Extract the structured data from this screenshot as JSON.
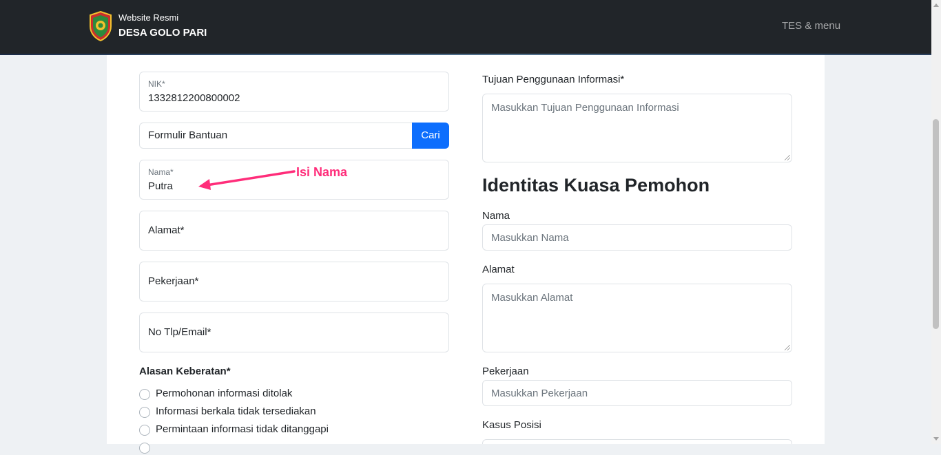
{
  "navbar": {
    "brand_top": "Website Resmi",
    "brand_main": "DESA GOLO PARI",
    "menu": "TES & menu",
    "logo_icon": "village-emblem-icon",
    "background": "#212529"
  },
  "form": {
    "nik": {
      "label": "NIK*",
      "value": "1332812200800002"
    },
    "formulir": {
      "value": "Formulir Bantuan",
      "button": "Cari"
    },
    "nama": {
      "label": "Nama*",
      "value": "Putra"
    },
    "alamat": {
      "label": "Alamat*"
    },
    "pekerjaan": {
      "label": "Pekerjaan*"
    },
    "kontak": {
      "label": "No Tlp/Email*"
    },
    "alasan": {
      "label": "Alasan Keberatan*",
      "options": [
        "Permohonan informasi ditolak",
        "Informasi berkala tidak tersediakan",
        "Permintaan informasi tidak ditanggapi"
      ]
    },
    "tujuan": {
      "label": "Tujuan Penggunaan Informasi*",
      "placeholder": "Masukkan Tujuan Penggunaan Informasi"
    }
  },
  "kuasa": {
    "heading": "Identitas Kuasa Pemohon",
    "nama": {
      "label": "Nama",
      "placeholder": "Masukkan Nama"
    },
    "alamat": {
      "label": "Alamat",
      "placeholder": "Masukkan Alamat"
    },
    "pekerjaan": {
      "label": "Pekerjaan",
      "placeholder": "Masukkan Pekerjaan"
    },
    "kasus": {
      "label": "Kasus Posisi"
    }
  },
  "annotation": {
    "text": "Isi Nama",
    "color": "#ff2d7a"
  },
  "colors": {
    "primary": "#0d6efd"
  }
}
